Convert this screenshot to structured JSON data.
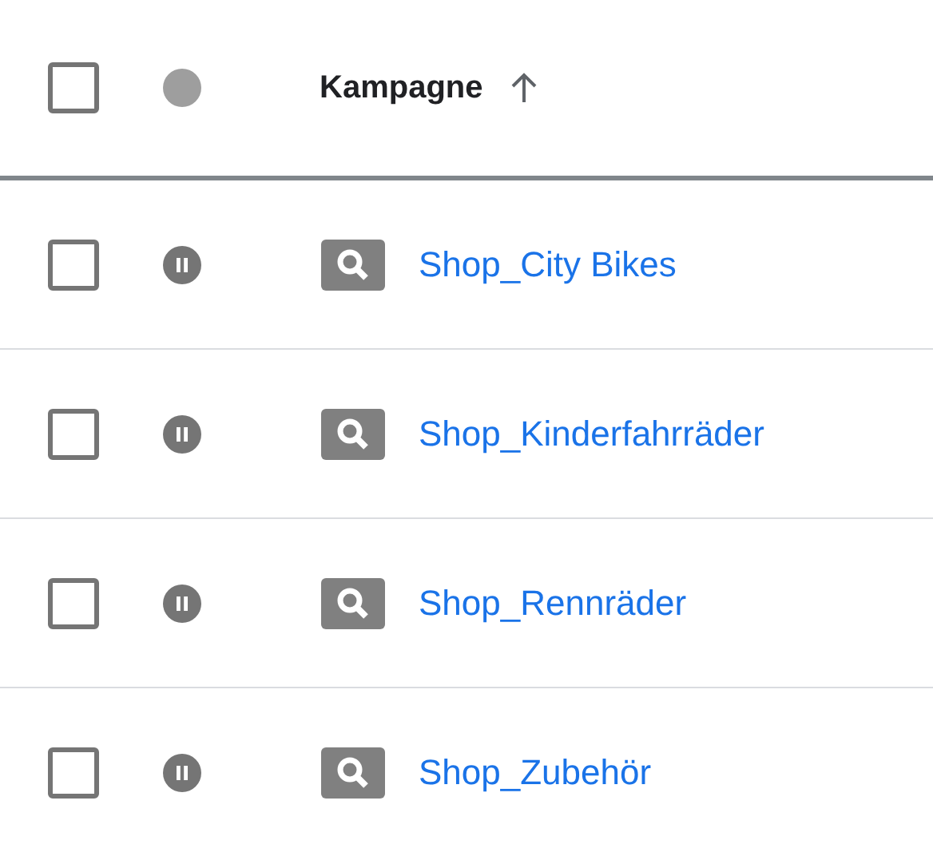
{
  "header": {
    "checked": false,
    "column": "Kampagne",
    "ascending": true
  },
  "rows": [
    {
      "checked": false,
      "paused": true,
      "kind": "search",
      "name": "Shop_City Bikes"
    },
    {
      "checked": false,
      "paused": true,
      "kind": "search",
      "name": "Shop_Kinderfahrräder"
    },
    {
      "checked": false,
      "paused": true,
      "kind": "search",
      "name": "Shop_Rennräder"
    },
    {
      "checked": false,
      "paused": true,
      "kind": "search",
      "name": "Shop_Zubehör"
    }
  ]
}
